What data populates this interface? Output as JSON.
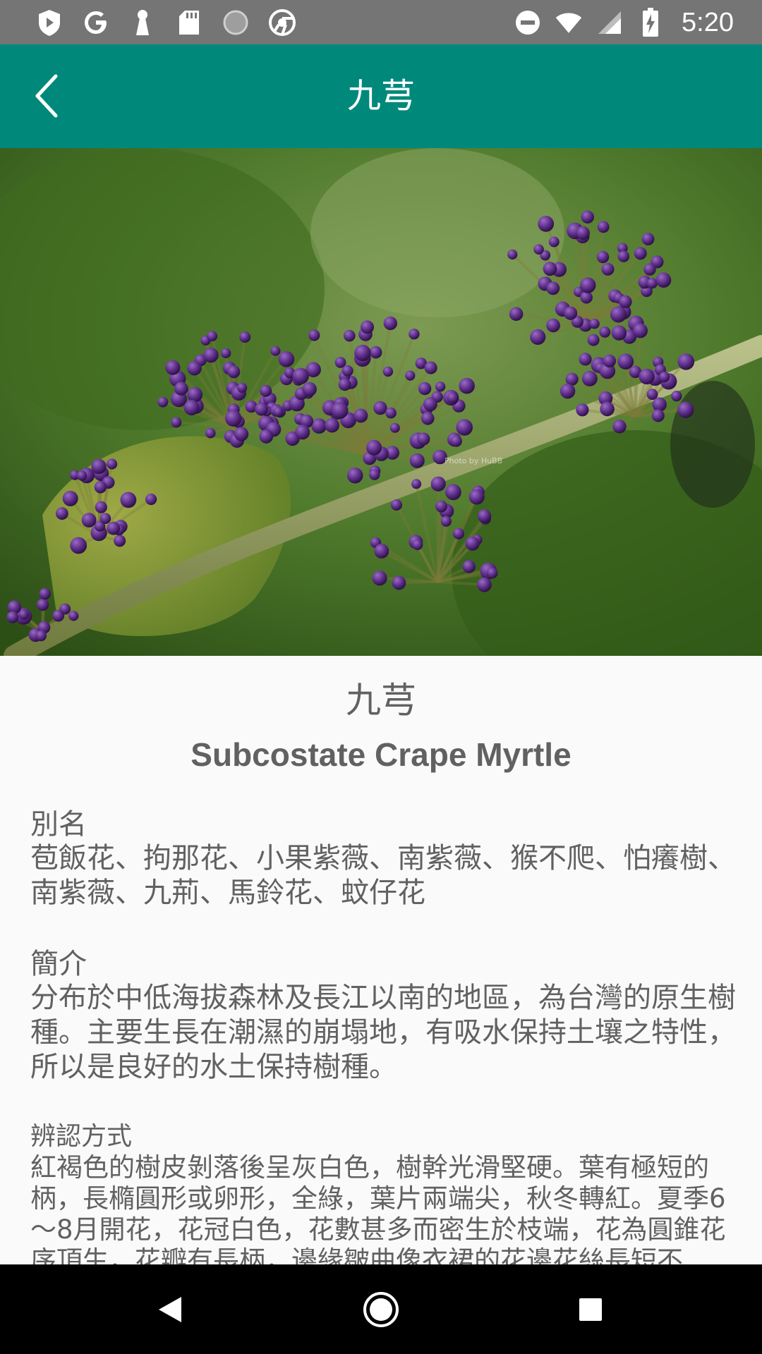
{
  "status_bar": {
    "time": "5:20",
    "left_icons": [
      "shield-icon",
      "google-icon",
      "keyhole-icon",
      "sd-card-icon",
      "loading-icon",
      "chrome-icon"
    ],
    "right_icons": [
      "do-not-disturb-icon",
      "wifi-icon",
      "signal-icon",
      "battery-charging-icon"
    ]
  },
  "app_bar": {
    "title": "九芎",
    "background": "#00897b"
  },
  "hero": {
    "watermark": "Photo by HuBB"
  },
  "plant": {
    "name_zh": "九芎",
    "name_en": "Subcostate Crape Myrtle"
  },
  "sections": [
    {
      "heading": "別名",
      "body": "苞飯花、拘那花、小果紫薇、南紫薇、猴不爬、怕癢樹、南紫薇、九荊、馬鈴花、蚊仔花"
    },
    {
      "heading": "簡介",
      "body": "分布於中低海拔森林及長江以南的地區，為台灣的原生樹種。主要生長在潮濕的崩塌地，有吸水保持土壤之特性，所以是良好的水土保持樹種。"
    },
    {
      "heading": "辨認方式",
      "body": "紅褐色的樹皮剝落後呈灰白色，樹幹光滑堅硬。葉有極短的柄，長橢圓形或卵形，全綠，葉片兩端尖，秋冬轉紅。夏季6～8月開花，花冠白色，花數甚多而密生於枝端，花為圓錐花序頂生，花瓣有長柄，邊緣皺曲像衣裙的花邊花絲長短不"
    }
  ],
  "nav_bar": {
    "icons": [
      "back-triangle-icon",
      "home-circle-icon",
      "recents-square-icon"
    ]
  }
}
